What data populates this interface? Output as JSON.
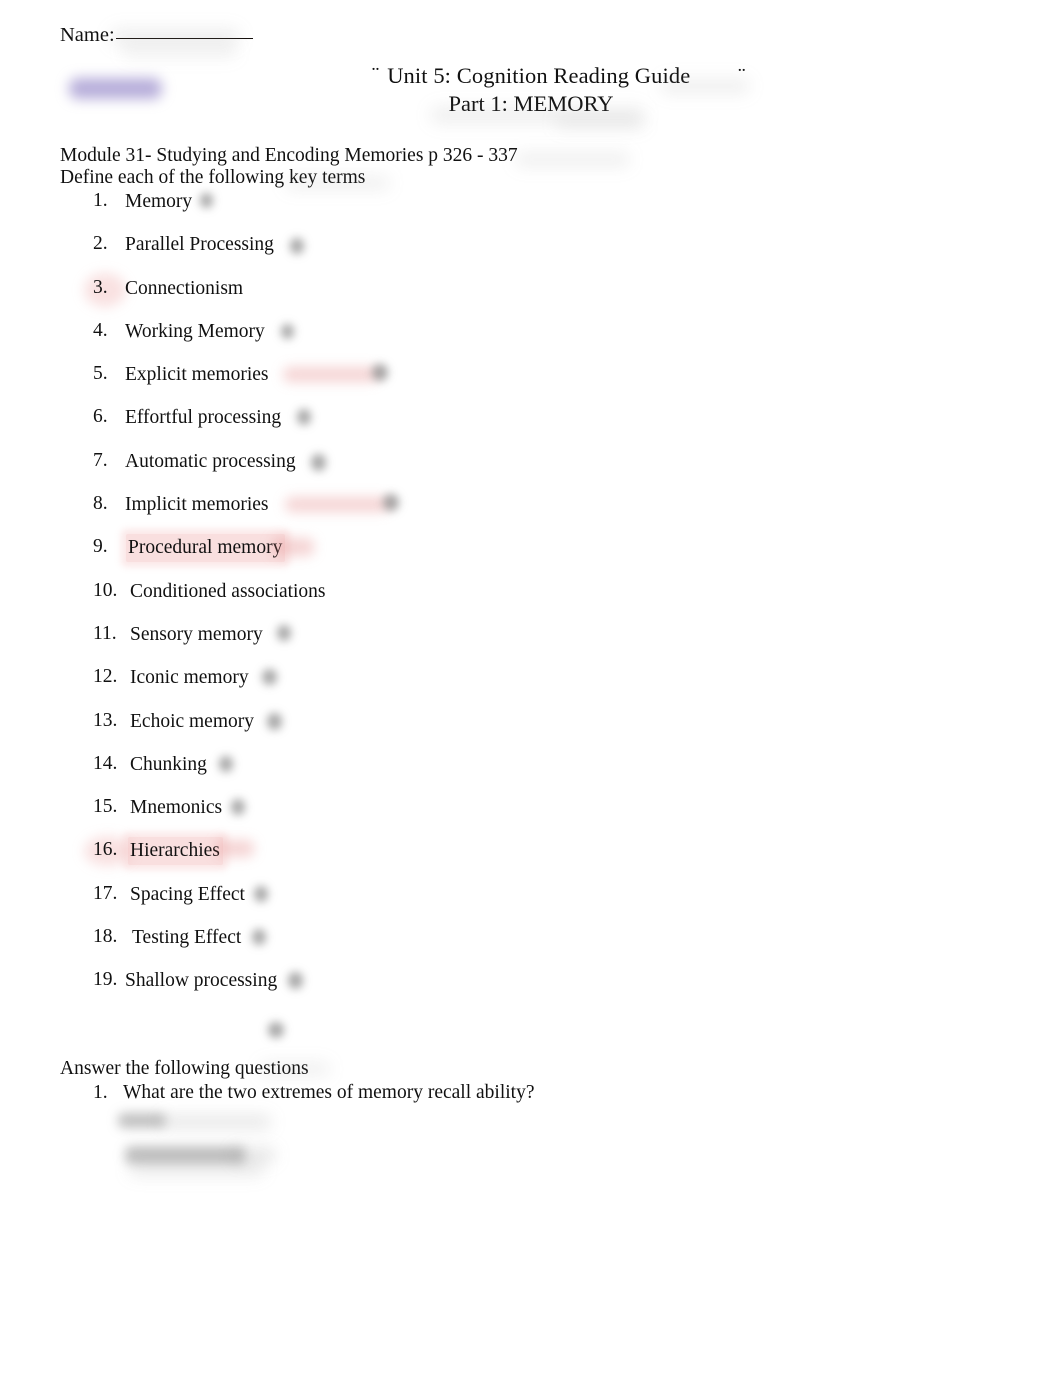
{
  "document": {
    "name_field": {
      "label": "Name:",
      "value": "",
      "rule": "____________"
    },
    "title": {
      "line1": "Unit 5: Cognition Reading Guide",
      "line2": "Part 1: MEMORY",
      "lead_marks": "¨",
      "trail_marks": "¨"
    },
    "module_heading": "Module 31- Studying and Encoding Memories p 326 - 337",
    "define_instruction": "Define each of the following key terms",
    "key_terms": [
      {
        "number": "1.",
        "label": "Memory",
        "highlighted": false
      },
      {
        "number": "2.",
        "label": "Parallel Processing",
        "highlighted": false
      },
      {
        "number": "3.",
        "label": "Connectionism",
        "highlighted": false
      },
      {
        "number": "4.",
        "label": "Working Memory",
        "highlighted": false
      },
      {
        "number": "5.",
        "label": "Explicit memories",
        "highlighted": false
      },
      {
        "number": "6.",
        "label": "Effortful processing",
        "highlighted": false
      },
      {
        "number": "7.",
        "label": "Automatic processing",
        "highlighted": false
      },
      {
        "number": "8.",
        "label": "Implicit memories",
        "highlighted": false
      },
      {
        "number": "9.",
        "label": "Procedural memory",
        "highlighted": true
      },
      {
        "number": "10.",
        "label": "Conditioned associations",
        "highlighted": false
      },
      {
        "number": "11.",
        "label": "Sensory memory",
        "highlighted": false
      },
      {
        "number": "12.",
        "label": "Iconic memory",
        "highlighted": false
      },
      {
        "number": "13.",
        "label": "Echoic memory",
        "highlighted": false
      },
      {
        "number": "14.",
        "label": "Chunking",
        "highlighted": false
      },
      {
        "number": "15.",
        "label": "Mnemonics",
        "highlighted": false
      },
      {
        "number": "16.",
        "label": "Hierarchies",
        "highlighted": true
      },
      {
        "number": "17.",
        "label": "Spacing Effect",
        "highlighted": false
      },
      {
        "number": "18.",
        "label": "Testing Effect",
        "highlighted": false
      },
      {
        "number": "19.",
        "label": "Shallow processing",
        "highlighted": false
      }
    ],
    "answer_section": {
      "heading": "Answer the following questions",
      "questions": [
        {
          "number": "1.",
          "text": "What are the two extremes of memory recall ability?"
        }
      ]
    },
    "colors": {
      "text": "#111111",
      "pink_highlight": "#ec9696",
      "purple_redaction": "#8b7cc4",
      "gray_redaction": "#5c5c5c"
    }
  }
}
